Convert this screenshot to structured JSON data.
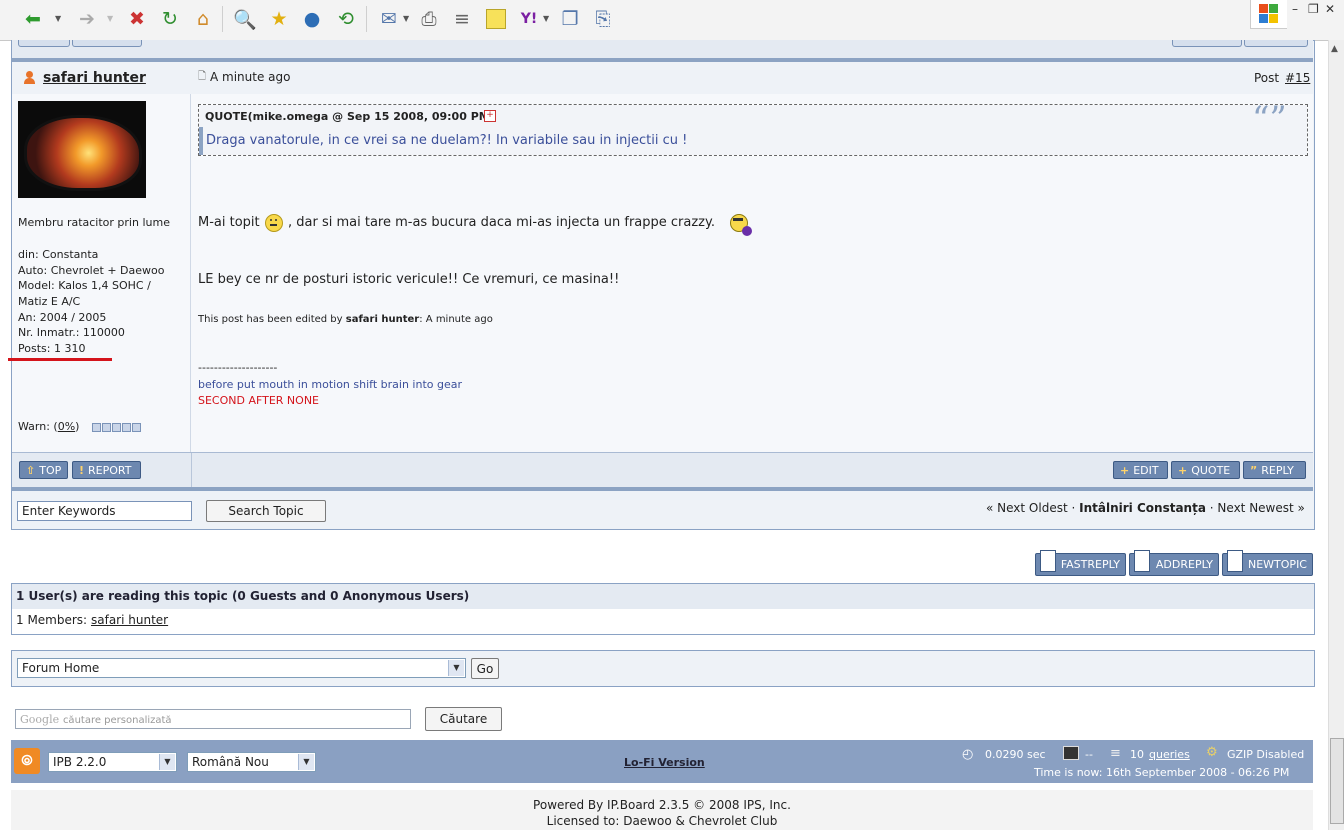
{
  "browser": {
    "toolbar_icons": [
      "back-icon",
      "forward-icon",
      "stop-icon",
      "refresh-icon",
      "home-icon",
      "search-icon",
      "favorites-icon",
      "globe-icon",
      "history-icon",
      "mail-icon",
      "print-icon",
      "edit-icon",
      "note-icon",
      "yahoo-icon",
      "copy-icon",
      "paste-icon"
    ]
  },
  "post": {
    "author": "safari hunter",
    "timestamp": "A minute ago",
    "post_label": "Post",
    "post_number": "#15",
    "author_info": {
      "title": "Membru ratacitor prin lume",
      "lines": [
        "din: Constanta",
        "Auto: Chevrolet + Daewoo",
        "Model: Kalos 1,4 SOHC /",
        "Matiz E A/C",
        "An: 2004 / 2005",
        "Nr. Inmatr.: 110000",
        "Posts: 1 310"
      ],
      "warn_label": "Warn: (",
      "warn_value": "0%",
      "warn_close": ")"
    },
    "quote": {
      "header": "QUOTE(mike.omega @ Sep 15 2008, 09:00 PM)",
      "text": "Draga vanatorule, in ce vrei sa ne duelam?! In variabile sau in injectii cu !"
    },
    "body": {
      "line1_a": "M-ai topit",
      "line1_b": ", dar si mai tare m-as bucura daca mi-as injecta un frappe crazzy.",
      "line2": "LE bey ce nr de posturi istoric vericule!! Ce vremuri, ce masina!!",
      "edited_prefix": "This post has been edited by",
      "edited_by": "safari hunter",
      "edited_suffix": ": A minute ago",
      "sig_divider": "--------------------",
      "sig_line1": "before put mouth in motion shift brain into gear",
      "sig_line2": "SECOND AFTER NONE"
    },
    "buttons": {
      "top": "TOP",
      "report": "REPORT",
      "edit": "EDIT",
      "quote": "QUOTE",
      "reply": "REPLY"
    }
  },
  "topic_search": {
    "input_value": "Enter Keywords",
    "button": "Search Topic"
  },
  "topic_nav": {
    "prev": "« Next Oldest",
    "sep1": "·",
    "current": "Intâlniri Constanța",
    "sep2": "·",
    "next": "Next Newest »"
  },
  "action_buttons": {
    "fastreply": "FASTREPLY",
    "addreply": "ADDREPLY",
    "newtopic": "NEWTOPIC"
  },
  "readers": {
    "header": "1 User(s) are reading this topic (0 Guests and 0 Anonymous Users)",
    "members_prefix": "1 Members:",
    "member": "safari hunter"
  },
  "jump": {
    "selected": "Forum Home",
    "go": "Go"
  },
  "google": {
    "brand": "Google",
    "placeholder": "căutare personalizată",
    "button": "Căutare"
  },
  "footer": {
    "skin": "IPB 2.2.0",
    "language": "Română Nou",
    "lofi": "Lo-Fi Version",
    "exec_time": "0.0290 sec",
    "dashes": "--",
    "queries_count": "10",
    "queries_label": "queries",
    "gzip": "GZIP Disabled",
    "time": "Time is now: 16th September 2008 - 06:26 PM",
    "powered": "Powered By IP.Board 2.3.5 © 2008  IPS, Inc.",
    "licensed": "Licensed to: Daewoo & Chevrolet Club"
  },
  "colors": {
    "accent": "#8aa0c2",
    "button": "#6d88b0",
    "quote_text": "#3b4f9a",
    "signature_red": "#d4141b",
    "underline_red": "#d4141b"
  }
}
